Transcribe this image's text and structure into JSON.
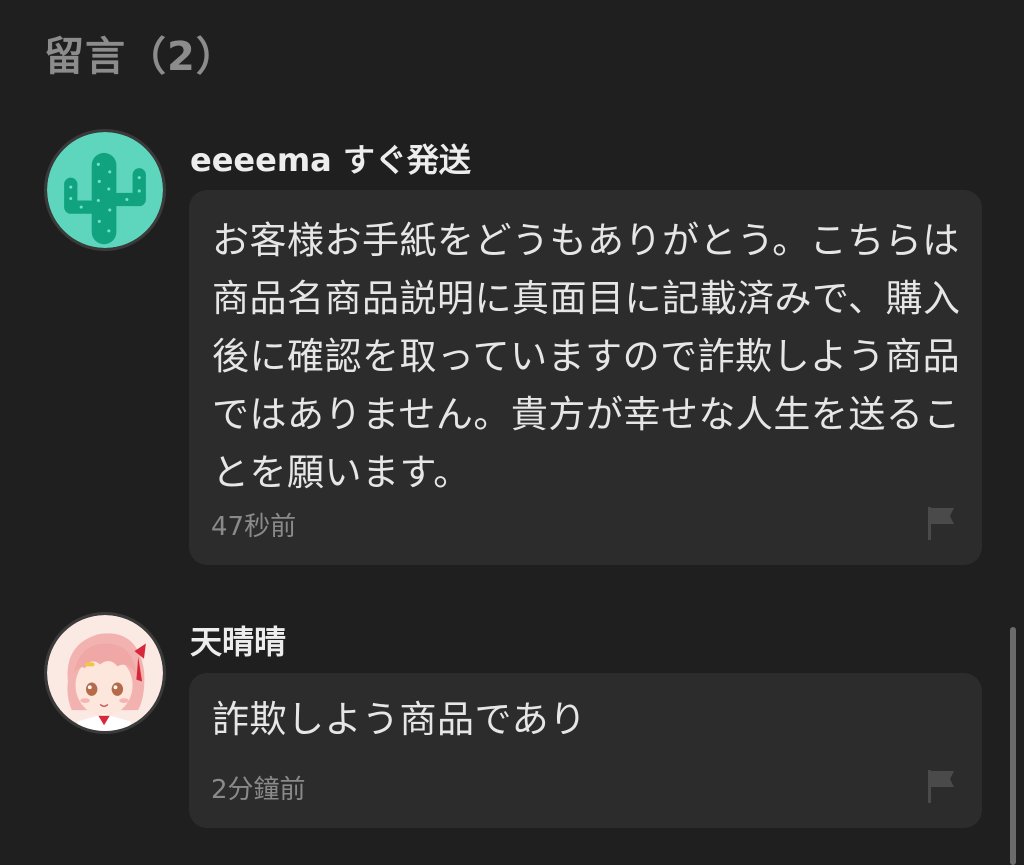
{
  "section": {
    "title": "留言（2）"
  },
  "comments": [
    {
      "username": "eeeema すぐ発送",
      "text": "お客様お手紙をどうもありがとう。こちらは商品名商品説明に真面目に記載済みで、購入後に確認を取っていますので詐欺しよう商品ではありません。貴方が幸せな人生を送ることを願います。",
      "time": "47秒前",
      "avatar_icon": "cactus-avatar-icon",
      "avatar_color": "#5ed6be"
    },
    {
      "username": "天晴晴",
      "text": "詐欺しよう商品であり",
      "time": "2分鐘前",
      "avatar_icon": "anime-girl-avatar-icon",
      "avatar_color": "#fbe9e4"
    }
  ],
  "colors": {
    "background": "#1f1f1f",
    "bubble": "#2c2c2c",
    "title": "#8c8c8c",
    "username": "#ededed",
    "text": "#e6e6e6",
    "muted": "#8a8a8a"
  }
}
